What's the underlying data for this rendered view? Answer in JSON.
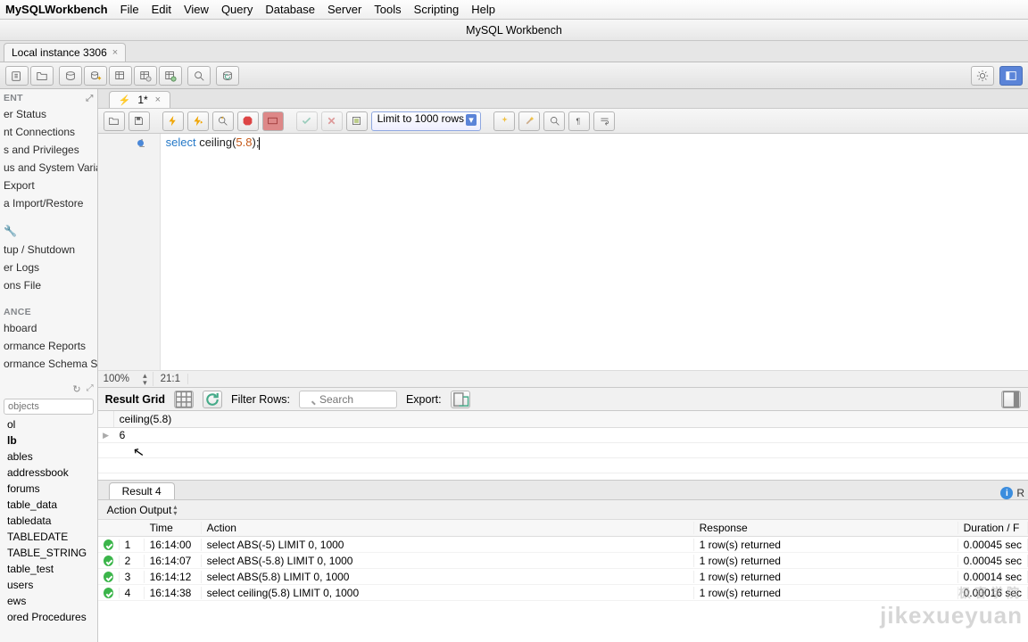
{
  "menubar": {
    "app": "MySQLWorkbench",
    "items": [
      "File",
      "Edit",
      "View",
      "Query",
      "Database",
      "Server",
      "Tools",
      "Scripting",
      "Help"
    ]
  },
  "window_title": "MySQL Workbench",
  "connection_tab": "Local instance 3306",
  "query_tab": {
    "label": "1*",
    "has_unsaved": true
  },
  "query_toolbar": {
    "limit_label": "Limit to 1000 rows"
  },
  "editor": {
    "line_no": "1",
    "code_tokens": {
      "select": "select",
      "fn": "ceiling",
      "open": "(",
      "num": "5.8",
      "close": ")",
      "semi": ";"
    }
  },
  "editor_status": {
    "zoom": "100%",
    "pos": "21:1"
  },
  "result_grid": {
    "label": "Result Grid",
    "filter_label": "Filter Rows:",
    "search_placeholder": "Search",
    "export_label": "Export:",
    "column": "ceiling(5.8)",
    "value": "6",
    "result_tab": "Result 4",
    "readonly_short": "R"
  },
  "action_output": {
    "label": "Action Output",
    "headers": {
      "time": "Time",
      "action": "Action",
      "response": "Response",
      "duration": "Duration / F"
    },
    "rows": [
      {
        "idx": "1",
        "time": "16:14:00",
        "action": "select ABS(-5) LIMIT 0, 1000",
        "response": "1 row(s) returned",
        "duration": "0.00045 sec"
      },
      {
        "idx": "2",
        "time": "16:14:07",
        "action": "select ABS(-5.8) LIMIT 0, 1000",
        "response": "1 row(s) returned",
        "duration": "0.00045 sec"
      },
      {
        "idx": "3",
        "time": "16:14:12",
        "action": "select ABS(5.8) LIMIT 0, 1000",
        "response": "1 row(s) returned",
        "duration": "0.00014 sec"
      },
      {
        "idx": "4",
        "time": "16:14:38",
        "action": "select ceiling(5.8) LIMIT 0, 1000",
        "response": "1 row(s) returned",
        "duration": "0.00016 sec"
      }
    ]
  },
  "sidebar": {
    "section1": "ENT",
    "mgmt": [
      "er Status",
      "nt Connections",
      "s and Privileges",
      "us and System Variab",
      "Export",
      "a Import/Restore"
    ],
    "mgmt2": [
      "tup / Shutdown",
      "er Logs",
      "ons File"
    ],
    "section2": "ANCE",
    "perf": [
      "hboard",
      "ormance Reports",
      "ormance Schema Set"
    ],
    "filter_placeholder": "objects",
    "schemas": [
      {
        "t": "ol",
        "b": false
      },
      {
        "t": "lb",
        "b": true
      },
      {
        "t": "ables",
        "b": false
      },
      {
        "t": "addressbook",
        "b": false
      },
      {
        "t": "forums",
        "b": false
      },
      {
        "t": "table_data",
        "b": false
      },
      {
        "t": "tabledata",
        "b": false
      },
      {
        "t": "TABLEDATE",
        "b": false
      },
      {
        "t": "TABLE_STRING",
        "b": false
      },
      {
        "t": "table_test",
        "b": false
      },
      {
        "t": "users",
        "b": false
      },
      {
        "t": "ews",
        "b": false
      },
      {
        "t": "ored Procedures",
        "b": false
      }
    ]
  },
  "watermark": {
    "cn": "极客学院",
    "en": "jikexueyuan"
  }
}
